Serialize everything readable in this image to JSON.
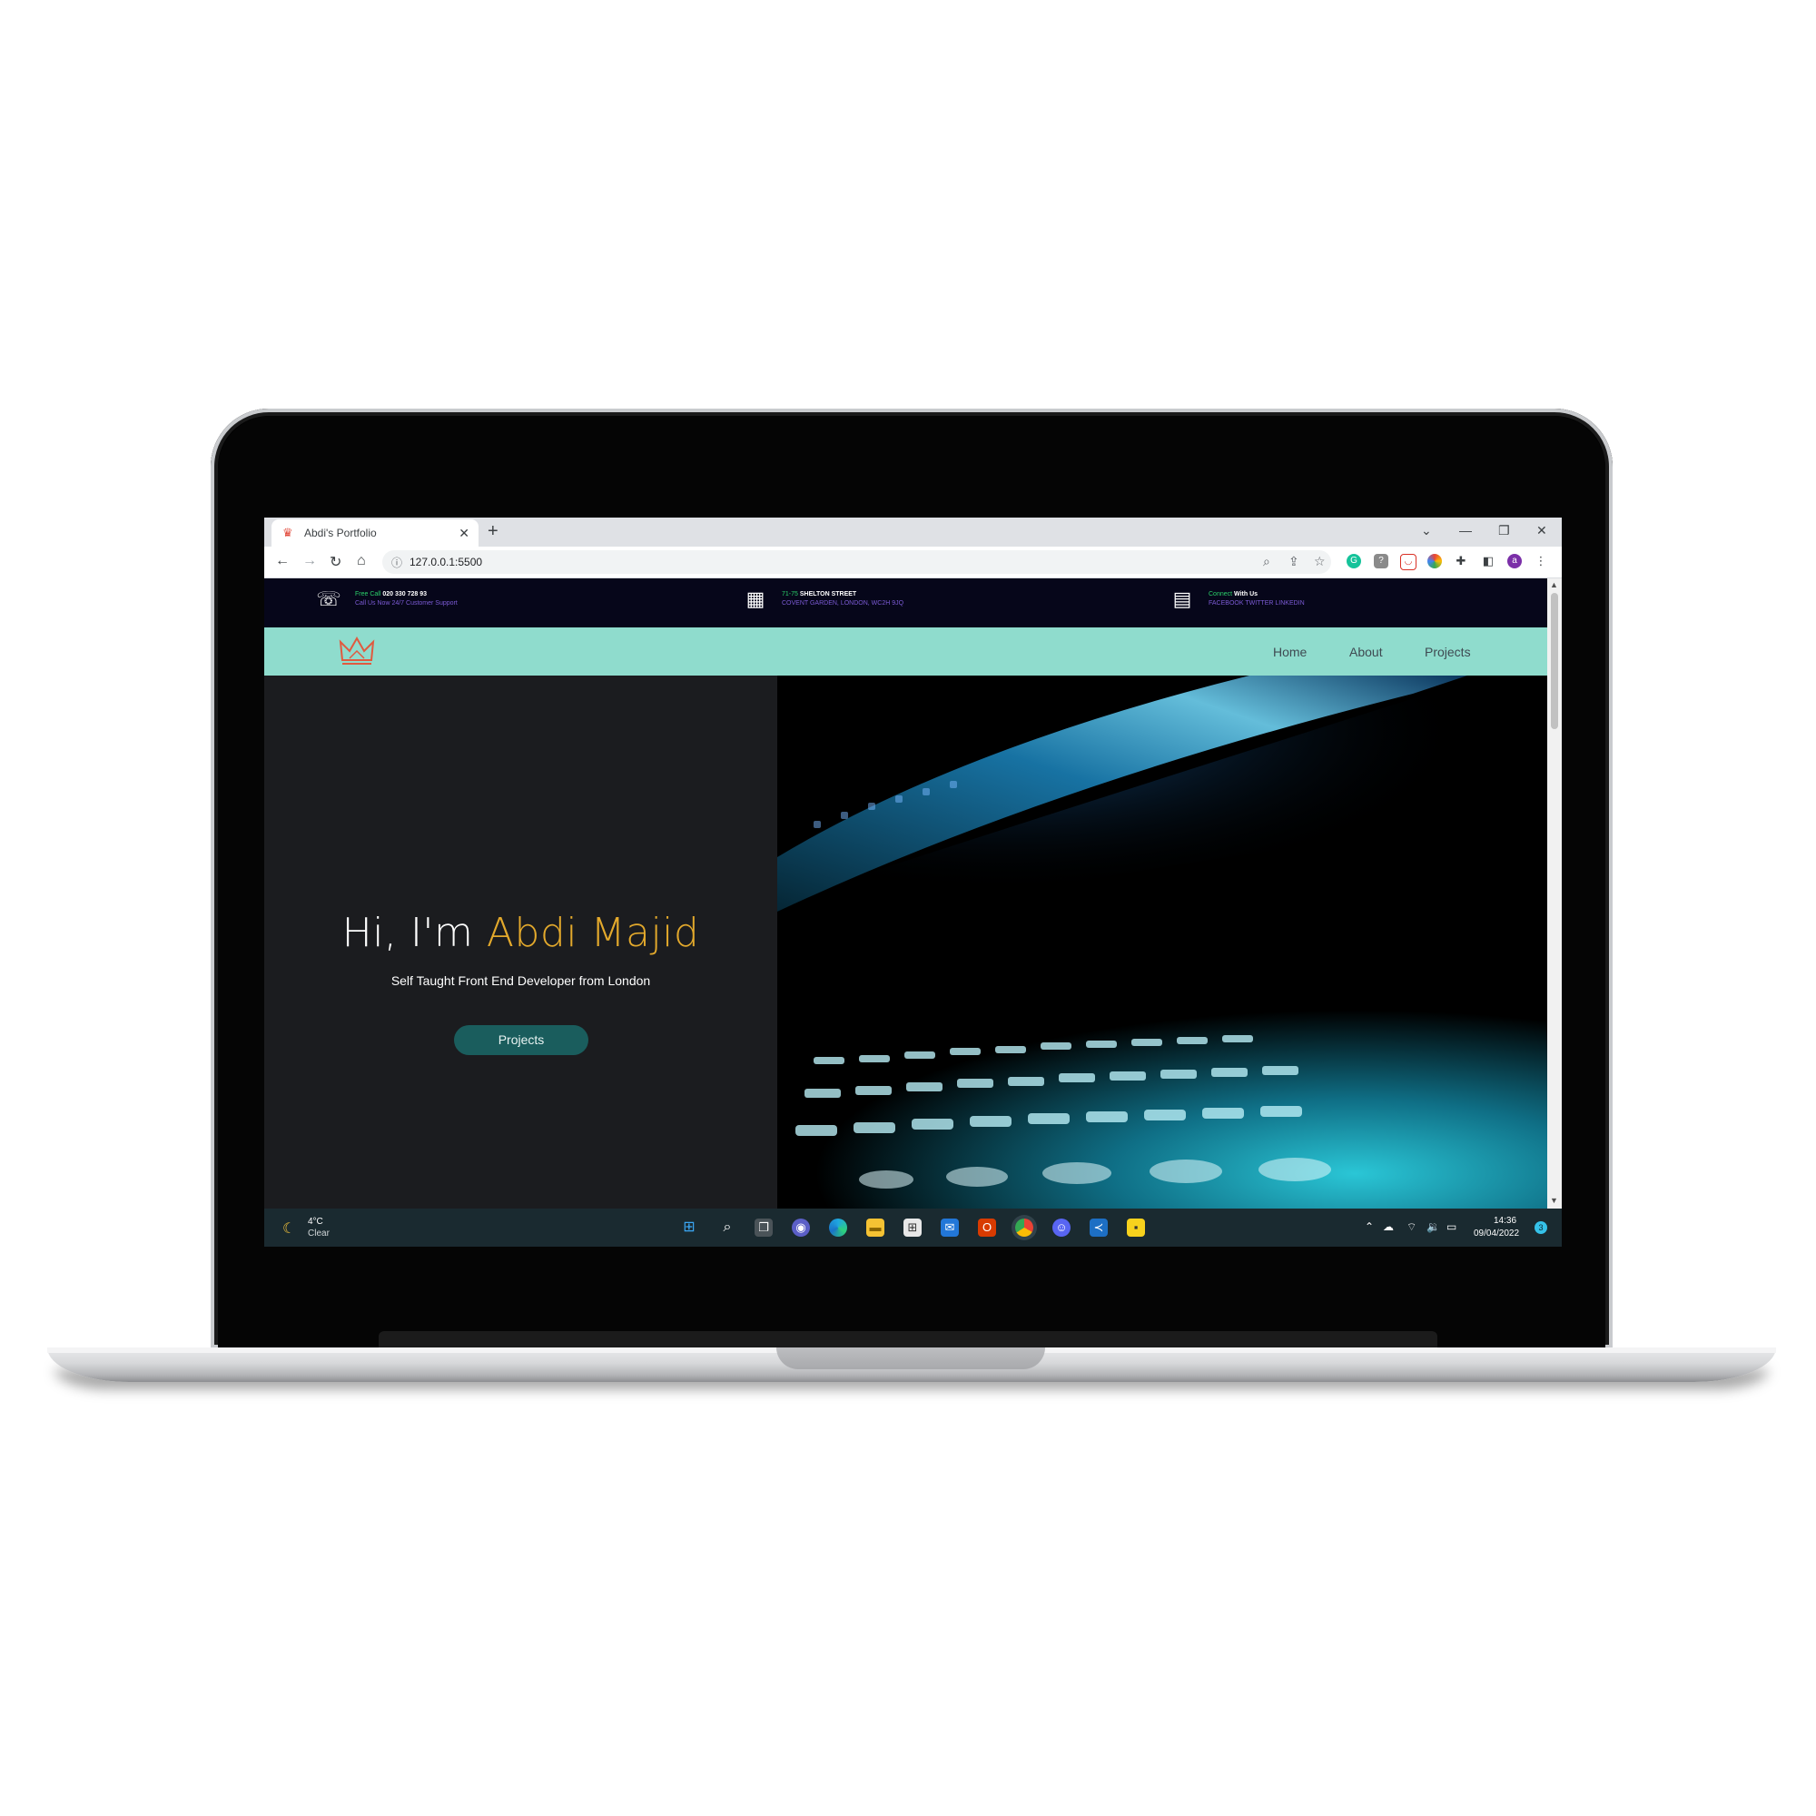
{
  "browser": {
    "tab_title": "Abdi's Portfolio",
    "tab_close": "✕",
    "new_tab": "+",
    "url": "127.0.0.1:5500",
    "minimize": "—",
    "restore": "❐",
    "close": "✕",
    "chevron": "⌄",
    "profile_initial": "a"
  },
  "infobar": {
    "call": {
      "highlight": "Free Call",
      "line1": " 020 330 728 93",
      "line2": "Call Us Now 24/7 Customer Support"
    },
    "address": {
      "highlight": "71-75",
      "line1": " SHELTON STREET",
      "line2": "COVENT GARDEN, LONDON, WC2H 9JQ"
    },
    "connect": {
      "highlight": "Connect",
      "line1": " With Us",
      "line2": "FACEBOOK TWITTER LINKEDIN"
    }
  },
  "nav": {
    "links": [
      "Home",
      "About",
      "Projects"
    ]
  },
  "hero": {
    "greeting": "Hi, I'm ",
    "name": "Abdi Majid",
    "subtitle": "Self Taught Front End Developer from London",
    "button": "Projects"
  },
  "taskbar": {
    "weather_temp": "4°C",
    "weather_desc": "Clear",
    "time": "14:36",
    "date": "09/04/2022",
    "notifications": "3"
  },
  "colors": {
    "nav_bg": "#8fdccd",
    "name_accent": "#e3a92c",
    "button_bg": "#1a5d5d",
    "info_highlight": "#2bd16a",
    "info_secondary": "#7c5bd6"
  }
}
